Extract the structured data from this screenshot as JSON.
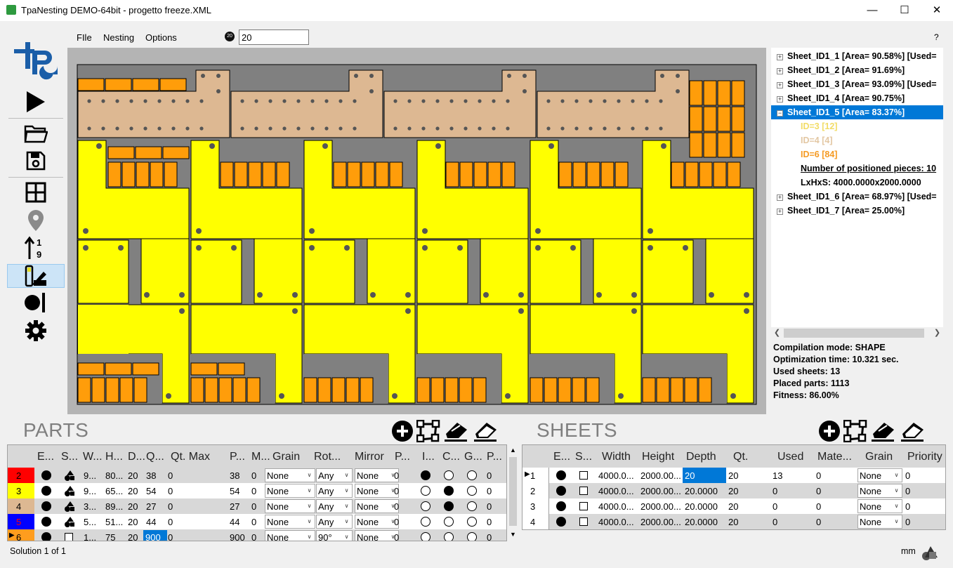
{
  "window": {
    "title": "TpaNesting DEMO-64bit - progetto freeze.XML",
    "minimize": "—",
    "maximize": "☐",
    "close": "✕"
  },
  "menu": {
    "file": "FIle",
    "nesting": "Nesting",
    "options": "Options",
    "timer_badge": "20",
    "timer_value": "20",
    "help": "?"
  },
  "toolbar": [
    "run-icon",
    "open-folder-icon",
    "save-icon",
    "grid-layout-icon",
    "location-pin-icon",
    "sort-numeric-icon",
    "color-shapes-icon",
    "circle-bar-icon",
    "gear-icon"
  ],
  "tree": {
    "items": [
      {
        "label": "Sheet_ID1_1 [Area= 90.58%] [Used=",
        "exp": "+"
      },
      {
        "label": "Sheet_ID1_2 [Area= 91.69%]",
        "exp": "+"
      },
      {
        "label": "Sheet_ID1_3 [Area= 93.09%] [Used=",
        "exp": "+"
      },
      {
        "label": "Sheet_ID1_4 [Area= 90.75%]",
        "exp": "+"
      },
      {
        "label": "Sheet_ID1_5 [Area= 83.37%]",
        "exp": "−"
      },
      {
        "label": "Sheet_ID1_6 [Area= 68.97%] [Used=",
        "exp": "+"
      },
      {
        "label": "Sheet_ID1_7 [Area= 25.00%]",
        "exp": "+"
      }
    ],
    "children": [
      {
        "label": "ID=3 [12]",
        "color": "#f7e35a"
      },
      {
        "label": "ID=4 [4]",
        "color": "#e8c8a0"
      },
      {
        "label": "ID=6 [84]",
        "color": "#ff9d1e"
      }
    ],
    "positioned": "Number of positioned pieces: 10",
    "lxhxs": "LxHxS: 4000.0000x2000.0000"
  },
  "info": {
    "compilation": "Compilation mode: SHAPE",
    "time": "Optimization time: 10.321 sec.",
    "sheets": "Used sheets: 13",
    "parts": "Placed parts: 1113",
    "fitness": "Fitness: 86.00%"
  },
  "parts": {
    "title": "PARTS",
    "headers": [
      "E...",
      "S...",
      "W...",
      "H...",
      "D...",
      "Q...",
      "Qt. Max",
      "P...",
      "M...",
      "Grain",
      "Rot...",
      "Mirror",
      "P...",
      "I...",
      "C...",
      "G...",
      "P..."
    ],
    "rows": [
      {
        "id": "2",
        "color": "#ff0000",
        "w": "9...",
        "h": "80...",
        "d": "20",
        "q": "38",
        "qmax": "0",
        "p": "38",
        "m": "0",
        "grain": "None",
        "rot": "Any",
        "mirror": "None",
        "p2": "0",
        "i": "dot",
        "c": "ring",
        "g": "ring",
        "p3": "0",
        "shape": "mix"
      },
      {
        "id": "3",
        "color": "#ffff00",
        "w": "9...",
        "h": "65...",
        "d": "20",
        "q": "54",
        "qmax": "0",
        "p": "54",
        "m": "0",
        "grain": "None",
        "rot": "Any",
        "mirror": "None",
        "p2": "0",
        "i": "ring",
        "c": "dot",
        "g": "ring",
        "p3": "0",
        "shape": "mix"
      },
      {
        "id": "4",
        "color": "#ddb892",
        "w": "3...",
        "h": "89...",
        "d": "20",
        "q": "27",
        "qmax": "0",
        "p": "27",
        "m": "0",
        "grain": "None",
        "rot": "Any",
        "mirror": "None",
        "p2": "0",
        "i": "ring",
        "c": "dot",
        "g": "ring",
        "p3": "0",
        "shape": "mix"
      },
      {
        "id": "5",
        "color": "#0000ff",
        "w": "5...",
        "h": "51...",
        "d": "20",
        "q": "44",
        "qmax": "0",
        "p": "44",
        "m": "0",
        "grain": "None",
        "rot": "Any",
        "mirror": "None",
        "p2": "0",
        "i": "ring",
        "c": "ring",
        "g": "ring",
        "p3": "0",
        "shape": "mix"
      },
      {
        "id": "6",
        "color": "#ff9d1e",
        "w": "1...",
        "h": "75",
        "d": "20",
        "q": "900",
        "qmax": "0",
        "p": "900",
        "m": "0",
        "grain": "None",
        "rot": "90°",
        "mirror": "None",
        "p2": "0",
        "i": "ring",
        "c": "ring",
        "g": "ring",
        "p3": "0",
        "shape": "square"
      }
    ]
  },
  "sheets": {
    "title": "SHEETS",
    "headers": [
      "E...",
      "S...",
      "Width",
      "Height",
      "Depth",
      "Qt.",
      "Used",
      "Mate...",
      "Grain",
      "Priority"
    ],
    "rows": [
      {
        "id": "1",
        "w": "4000.0...",
        "h": "2000.00...",
        "d": "20",
        "qt": "20",
        "used": "13",
        "mat": "0",
        "grain": "None",
        "prio": "0"
      },
      {
        "id": "2",
        "w": "4000.0...",
        "h": "2000.00...",
        "d": "20.0000",
        "qt": "20",
        "used": "0",
        "mat": "0",
        "grain": "None",
        "prio": "0"
      },
      {
        "id": "3",
        "w": "4000.0...",
        "h": "2000.00...",
        "d": "20.0000",
        "qt": "20",
        "used": "0",
        "mat": "0",
        "grain": "None",
        "prio": "0"
      },
      {
        "id": "4",
        "w": "4000.0...",
        "h": "2000.00...",
        "d": "20.0000",
        "qt": "20",
        "used": "0",
        "mat": "0",
        "grain": "None",
        "prio": "0"
      }
    ]
  },
  "status": {
    "solution": "Solution 1 of 1",
    "unit": "mm"
  }
}
